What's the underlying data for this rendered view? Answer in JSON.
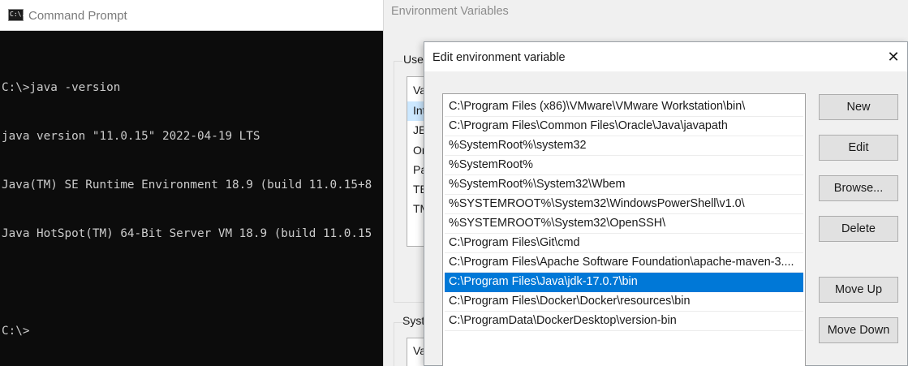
{
  "cmd": {
    "title": "Command Prompt",
    "icon_text": "C:\\.",
    "lines": [
      "C:\\>java -version",
      "java version \"11.0.15\" 2022-04-19 LTS",
      "Java(TM) SE Runtime Environment 18.9 (build 11.0.15+8",
      "Java HotSpot(TM) 64-Bit Server VM 18.9 (build 11.0.15",
      "",
      "C:\\>"
    ]
  },
  "env_dialog": {
    "title": "Environment Variables",
    "user_group_label": "User",
    "user_rows": [
      "Va",
      "Int",
      "JET",
      "On",
      "Pa",
      "TE",
      "TM"
    ],
    "system_group_label": "Syste",
    "system_rows": [
      "Va"
    ]
  },
  "edit_dialog": {
    "title": "Edit environment variable",
    "close_glyph": "✕",
    "paths": [
      "C:\\Program Files (x86)\\VMware\\VMware Workstation\\bin\\",
      "C:\\Program Files\\Common Files\\Oracle\\Java\\javapath",
      "%SystemRoot%\\system32",
      "%SystemRoot%",
      "%SystemRoot%\\System32\\Wbem",
      "%SYSTEMROOT%\\System32\\WindowsPowerShell\\v1.0\\",
      "%SYSTEMROOT%\\System32\\OpenSSH\\",
      "C:\\Program Files\\Git\\cmd",
      "C:\\Program Files\\Apache Software Foundation\\apache-maven-3....",
      "C:\\Program Files\\Java\\jdk-17.0.7\\bin",
      "C:\\Program Files\\Docker\\Docker\\resources\\bin",
      "C:\\ProgramData\\DockerDesktop\\version-bin"
    ],
    "selected_index": 9,
    "buttons": {
      "new": "New",
      "edit": "Edit",
      "browse": "Browse...",
      "delete": "Delete",
      "move_up": "Move Up",
      "move_down": "Move Down"
    }
  },
  "colors": {
    "selection": "#0078d7",
    "console_bg": "#0c0c0c",
    "console_text": "#cccccc"
  }
}
